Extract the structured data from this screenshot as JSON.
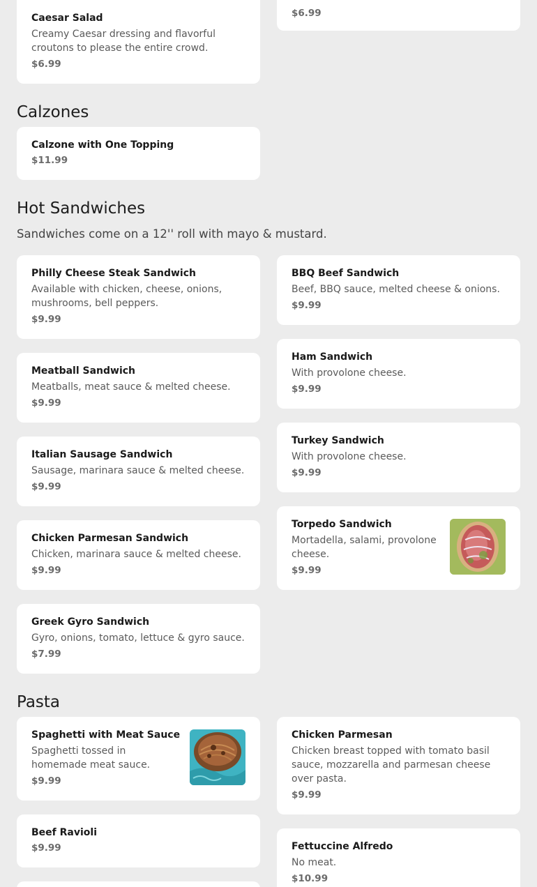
{
  "salads": {
    "caesar": {
      "name": "Caesar Salad",
      "desc": "Creamy Caesar dressing and flavorful croutons to please the entire crowd.",
      "price": "$6.99"
    },
    "right_partial": {
      "price": "$6.99"
    }
  },
  "calzones": {
    "title": "Calzones",
    "items": [
      {
        "name": "Calzone with One Topping",
        "price": "$11.99"
      }
    ]
  },
  "hot_sandwiches": {
    "title": "Hot Sandwiches",
    "note": "Sandwiches come on a 12'' roll with mayo & mustard.",
    "left": [
      {
        "name": "Philly Cheese Steak Sandwich",
        "desc": "Available with chicken, cheese, onions, mushrooms, bell peppers.",
        "price": "$9.99"
      },
      {
        "name": "Meatball Sandwich",
        "desc": "Meatballs, meat sauce & melted cheese.",
        "price": "$9.99"
      },
      {
        "name": "Italian Sausage Sandwich",
        "desc": "Sausage, marinara sauce & melted cheese.",
        "price": "$9.99"
      },
      {
        "name": "Chicken Parmesan Sandwich",
        "desc": "Chicken, marinara sauce & melted cheese.",
        "price": "$9.99"
      },
      {
        "name": "Greek Gyro Sandwich",
        "desc": "Gyro, onions, tomato, lettuce & gyro sauce.",
        "price": "$7.99"
      }
    ],
    "right": [
      {
        "name": "BBQ Beef Sandwich",
        "desc": "Beef, BBQ sauce, melted cheese & onions.",
        "price": "$9.99"
      },
      {
        "name": "Ham Sandwich",
        "desc": "With provolone cheese.",
        "price": "$9.99"
      },
      {
        "name": "Turkey Sandwich",
        "desc": "With provolone cheese.",
        "price": "$9.99"
      },
      {
        "name": "Torpedo Sandwich",
        "desc": "Mortadella, salami, provolone cheese.",
        "price": "$9.99",
        "image": "sandwich-photo"
      }
    ]
  },
  "pasta": {
    "title": "Pasta",
    "left": [
      {
        "name": "Spaghetti with Meat Sauce",
        "desc": "Spaghetti tossed in homemade meat sauce.",
        "price": "$9.99",
        "image": "spaghetti-photo"
      },
      {
        "name": "Beef Ravioli",
        "price": "$9.99"
      }
    ],
    "right": [
      {
        "name": "Chicken Parmesan",
        "desc": "Chicken breast topped with tomato basil sauce, mozzarella and parmesan cheese over pasta.",
        "price": "$9.99"
      },
      {
        "name": "Fettuccine Alfredo",
        "desc": "No meat.",
        "price": "$10.99"
      }
    ]
  }
}
